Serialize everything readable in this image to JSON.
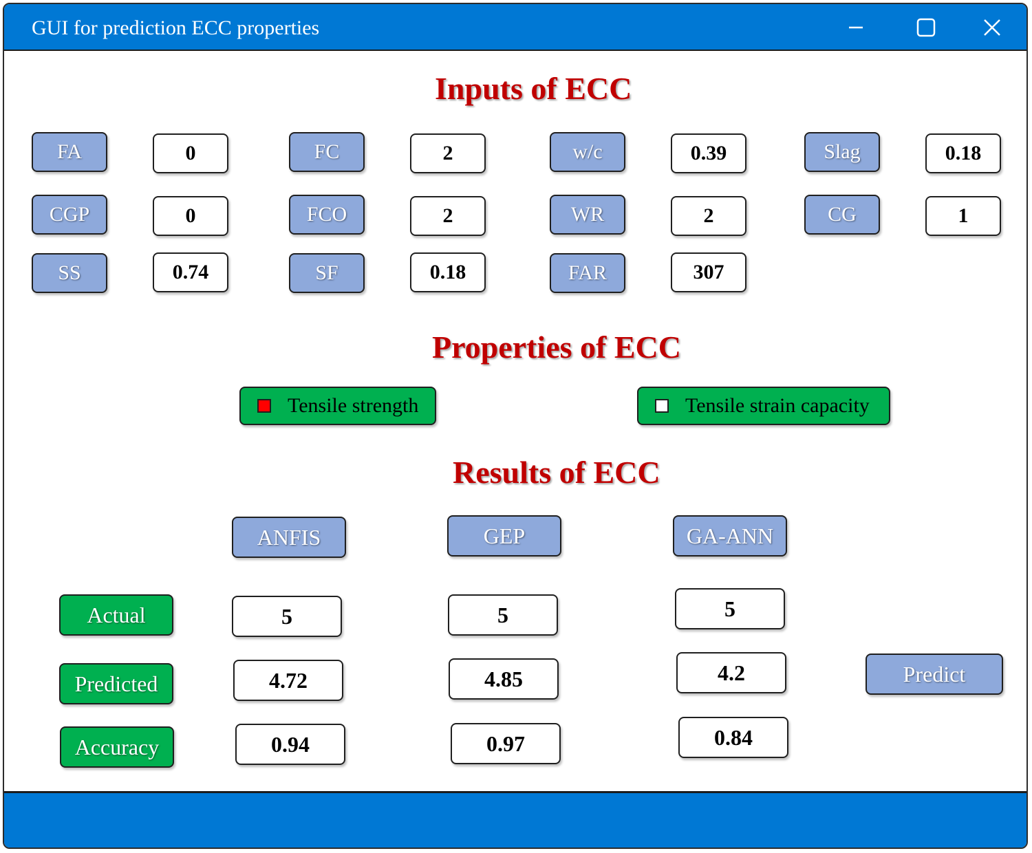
{
  "window": {
    "title": "GUI for prediction ECC properties",
    "controls": [
      "minimize-icon",
      "maximize-icon",
      "close-icon"
    ]
  },
  "inputs": {
    "heading": "Inputs of ECC",
    "fields": [
      {
        "label": "FA",
        "value": "0"
      },
      {
        "label": "FC",
        "value": "2"
      },
      {
        "label": "w/c",
        "value": "0.39"
      },
      {
        "label": "Slag",
        "value": "0.18"
      },
      {
        "label": "CGP",
        "value": "0"
      },
      {
        "label": "FCO",
        "value": "2"
      },
      {
        "label": "WR",
        "value": "2"
      },
      {
        "label": "CG",
        "value": "1"
      },
      {
        "label": "SS",
        "value": "0.74"
      },
      {
        "label": "SF",
        "value": "0.18"
      },
      {
        "label": "FAR",
        "value": "307"
      }
    ]
  },
  "properties": {
    "heading": "Properties of ECC",
    "options": [
      {
        "label": "Tensile strength",
        "checked": true,
        "indicator_color": "#ff0000"
      },
      {
        "label": "Tensile strain capacity",
        "checked": false,
        "indicator_color": "#ffffff"
      }
    ]
  },
  "results": {
    "heading": "Results of ECC",
    "models": [
      "ANFIS",
      "GEP",
      "GA-ANN"
    ],
    "rows": [
      {
        "label": "Actual",
        "values": [
          "5",
          "5",
          "5"
        ]
      },
      {
        "label": "Predicted",
        "values": [
          "4.72",
          "4.85",
          "4.2"
        ]
      },
      {
        "label": "Accuracy",
        "values": [
          "0.94",
          "0.97",
          "0.84"
        ]
      }
    ],
    "predict_label": "Predict"
  },
  "colors": {
    "titlebar": "#0078d4",
    "heading": "#c00000",
    "label_button": "#8ea9db",
    "green_button": "#00b050"
  }
}
